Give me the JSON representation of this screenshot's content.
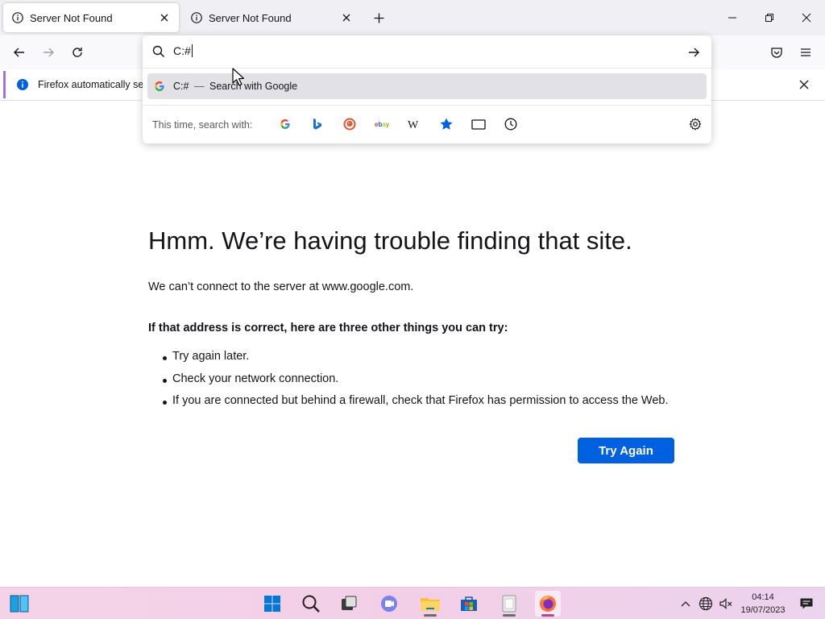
{
  "tabs": [
    {
      "title": "Server Not Found",
      "icon": "info-icon",
      "active": true
    },
    {
      "title": "Server Not Found",
      "icon": "info-icon",
      "active": false
    }
  ],
  "window_controls": [
    "minimize-icon",
    "restore-icon",
    "close-icon"
  ],
  "notification": {
    "text": "Firefox automatically sen",
    "accent_color": "#a86ee0",
    "info_color": "#0061e0"
  },
  "urlbar": {
    "value": "C:#",
    "suggestion": {
      "query": "C:#",
      "dash": "—",
      "action": "Search with Google"
    },
    "oneoffs_label": "This time, search with:",
    "engines": [
      "google-icon",
      "bing-icon",
      "duckduckgo-icon",
      "ebay-icon",
      "wikipedia-icon",
      "bookmarks-icon",
      "tabs-icon",
      "history-icon"
    ]
  },
  "error": {
    "title": "Hmm. We’re having trouble finding that site.",
    "description": "We can’t connect to the server at www.google.com.",
    "subhead": "If that address is correct, here are three other things you can try:",
    "suggestions": [
      "Try again later.",
      "Check your network connection.",
      "If you are connected but behind a firewall, check that Firefox has permission to access the Web."
    ],
    "button_label": "Try Again",
    "button_color": "#0061e0"
  },
  "taskbar": {
    "apps": [
      "widgets-icon",
      "start-icon",
      "search-icon",
      "task-view-icon",
      "chat-icon",
      "file-explorer-icon",
      "store-icon",
      "notepad-icon",
      "firefox-icon"
    ],
    "time": "04:14",
    "date": "19/07/2023"
  }
}
